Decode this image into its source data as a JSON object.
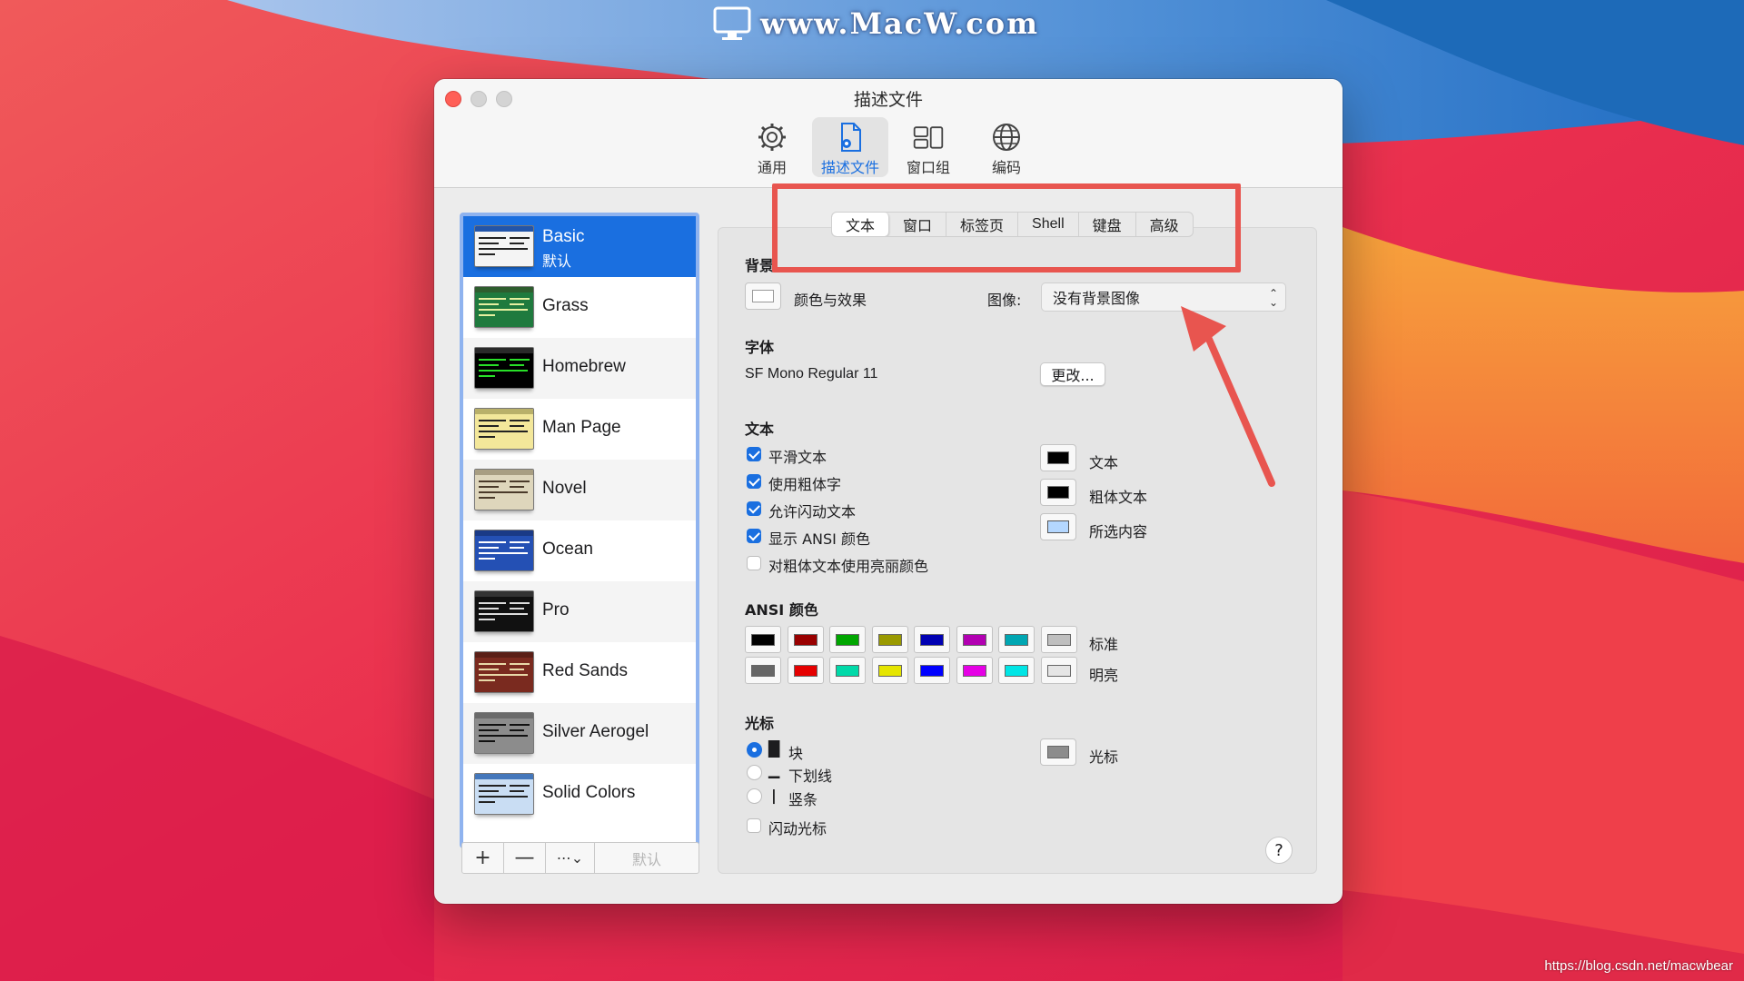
{
  "watermark_top": "www.MacW.com",
  "watermark_bottom": "https://blog.csdn.net/macwbear",
  "window": {
    "title": "描述文件",
    "toolbar": [
      {
        "label": "通用",
        "icon": "gear-icon"
      },
      {
        "label": "描述文件",
        "icon": "document-gear-icon",
        "active": true
      },
      {
        "label": "窗口组",
        "icon": "window-group-icon"
      },
      {
        "label": "编码",
        "icon": "globe-icon"
      }
    ]
  },
  "sidebar": {
    "profiles": [
      {
        "name": "Basic",
        "sub": "默认",
        "selected": true,
        "bg": "#f4f4f4",
        "bar": "#2255aa",
        "fg": "#222222"
      },
      {
        "name": "Grass",
        "bg": "#1f7a3e",
        "bar": "#2e5d2e",
        "fg": "#e6f0a0"
      },
      {
        "name": "Homebrew",
        "bg": "#000000",
        "bar": "#2a2a2a",
        "fg": "#28e028"
      },
      {
        "name": "Man Page",
        "bg": "#f3e79a",
        "bar": "#b9b06a",
        "fg": "#222222"
      },
      {
        "name": "Novel",
        "bg": "#ded6bc",
        "bar": "#a89e82",
        "fg": "#4a3a2a"
      },
      {
        "name": "Ocean",
        "bg": "#2450b4",
        "bar": "#1a3a86",
        "fg": "#ffffff"
      },
      {
        "name": "Pro",
        "bg": "#111111",
        "bar": "#333333",
        "fg": "#dddddd"
      },
      {
        "name": "Red Sands",
        "bg": "#7a2a1f",
        "bar": "#5a1f17",
        "fg": "#e8d8a8"
      },
      {
        "name": "Silver Aerogel",
        "bg": "#8c8c8c",
        "bar": "#6a6a6a",
        "fg": "#111111"
      },
      {
        "name": "Solid Colors",
        "bg": "#c9ddf3",
        "bar": "#4477bb",
        "fg": "#222222"
      }
    ],
    "buttons": {
      "add": "+",
      "remove": "—",
      "more": "⋯⌄",
      "default": "默认"
    }
  },
  "tabs": [
    "文本",
    "窗口",
    "标签页",
    "Shell",
    "键盘",
    "高级"
  ],
  "active_tab": "文本",
  "background": {
    "heading": "背景",
    "color_effect_label": "颜色与效果",
    "image_label": "图像:",
    "image_value": "没有背景图像"
  },
  "font": {
    "heading": "字体",
    "value": "SF Mono Regular 11",
    "change_button": "更改..."
  },
  "text": {
    "heading": "文本",
    "options": [
      {
        "label": "平滑文本",
        "checked": true
      },
      {
        "label": "使用粗体字",
        "checked": true
      },
      {
        "label": "允许闪动文本",
        "checked": true
      },
      {
        "label": "显示 ANSI 颜色",
        "checked": true
      },
      {
        "label": "对粗体文本使用亮丽颜色",
        "checked": false
      }
    ],
    "colors": [
      {
        "label": "文本",
        "color": "#000000"
      },
      {
        "label": "粗体文本",
        "color": "#000000"
      },
      {
        "label": "所选内容",
        "color": "#b4d7ff"
      }
    ]
  },
  "ansi": {
    "heading": "ANSI 颜色",
    "normal_label": "标准",
    "bright_label": "明亮",
    "normal": [
      "#000000",
      "#990000",
      "#00a600",
      "#999900",
      "#0000b2",
      "#b200b2",
      "#00a6b2",
      "#bfbfbf"
    ],
    "bright": [
      "#666666",
      "#e50000",
      "#00d9a8",
      "#e5e500",
      "#0000ff",
      "#e500e5",
      "#00e5e5",
      "#e5e5e5"
    ]
  },
  "cursor": {
    "heading": "光标",
    "options": [
      {
        "glyph": "█",
        "label": "块",
        "selected": true
      },
      {
        "glyph": "▁",
        "label": "下划线",
        "selected": false
      },
      {
        "glyph": "|",
        "label": "竖条",
        "selected": false
      }
    ],
    "blink_label": "闪动光标",
    "blink_checked": false,
    "color_label": "光标",
    "color": "#8c8c8c"
  },
  "help": "?",
  "colors": {
    "accent": "#1a6fe0",
    "highlight_box": "#e8554f"
  }
}
